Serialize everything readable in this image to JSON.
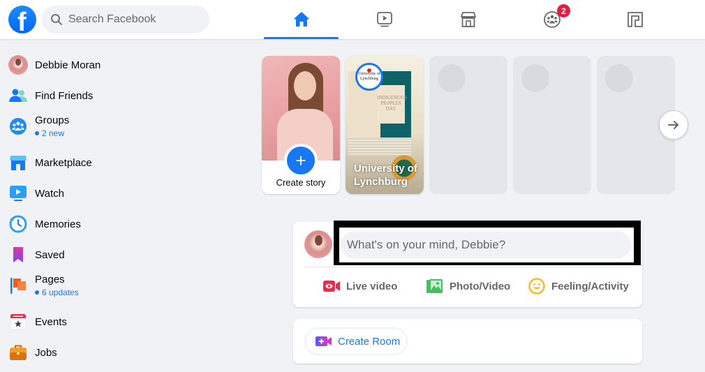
{
  "header": {
    "logo_letter": "f",
    "search_placeholder": "Search Facebook",
    "nav_tabs": [
      {
        "name": "home",
        "icon": "home-icon",
        "active": true
      },
      {
        "name": "watch",
        "icon": "video-play-icon",
        "active": false
      },
      {
        "name": "marketplace",
        "icon": "storefront-icon",
        "active": false
      },
      {
        "name": "groups",
        "icon": "groups-icon",
        "active": false,
        "badge": "2"
      },
      {
        "name": "gaming",
        "icon": "gaming-icon",
        "active": false
      }
    ],
    "colors": {
      "accent": "#1877f2",
      "badge": "#e41e3f"
    }
  },
  "sidebar": {
    "items": [
      {
        "label": "Debbie Moran",
        "icon": "profile-avatar"
      },
      {
        "label": "Find Friends",
        "icon": "friends-icon"
      },
      {
        "label": "Groups",
        "icon": "groups-icon",
        "sub": "2 new"
      },
      {
        "label": "Marketplace",
        "icon": "marketplace-icon"
      },
      {
        "label": "Watch",
        "icon": "watch-icon"
      },
      {
        "label": "Memories",
        "icon": "memories-clock-icon"
      },
      {
        "label": "Saved",
        "icon": "bookmark-icon"
      },
      {
        "label": "Pages",
        "icon": "flag-icon",
        "sub": "6 updates"
      },
      {
        "label": "Events",
        "icon": "calendar-star-icon"
      },
      {
        "label": "Jobs",
        "icon": "briefcase-icon"
      }
    ]
  },
  "stories": {
    "create_label": "Create story",
    "items": [
      {
        "title": "University of Lynchburg",
        "line1": "University of",
        "line2": "Lynchburg",
        "poster_text": "INDIGENOUS PEOPLES DAY",
        "logo_text": "University of Lynchburg"
      }
    ],
    "placeholder_count": 3,
    "next_icon": "arrow-right-icon"
  },
  "composer": {
    "placeholder": "What's on your mind, Debbie?",
    "actions": [
      {
        "label": "Live video",
        "icon": "live-video-icon",
        "color": "#f02849"
      },
      {
        "label": "Photo/Video",
        "icon": "photo-icon",
        "color": "#45bd62"
      },
      {
        "label": "Feeling/Activity",
        "icon": "smiley-icon",
        "color": "#f7b928"
      }
    ]
  },
  "room": {
    "button_label": "Create Room",
    "icon": "video-plus-icon"
  }
}
